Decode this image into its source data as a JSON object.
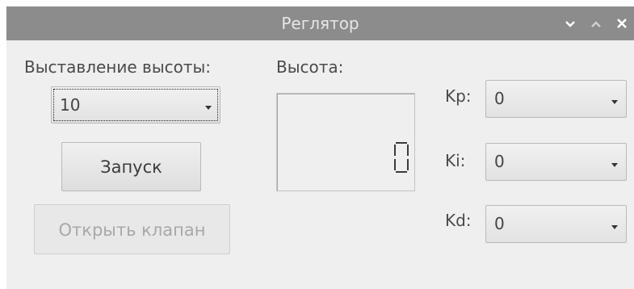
{
  "window": {
    "title": "Реглятор",
    "controls": [
      "minimize-icon",
      "maximize-icon",
      "close-icon"
    ]
  },
  "setpoint": {
    "label": "Выставление высоты:",
    "value": "10"
  },
  "start_button": "Запуск",
  "open_valve_button": "Открыть клапан",
  "height_display": {
    "label": "Высота:",
    "value": 0
  },
  "gains": [
    {
      "label": "Kp:",
      "value": "0"
    },
    {
      "label": "Ki:",
      "value": "0"
    },
    {
      "label": "Kd:",
      "value": "0"
    }
  ]
}
